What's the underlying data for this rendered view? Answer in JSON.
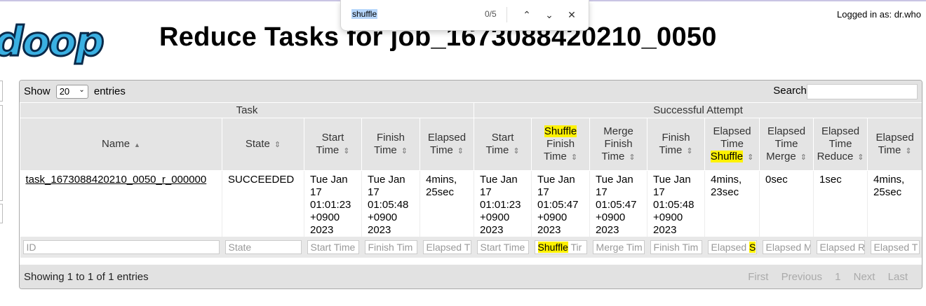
{
  "header": {
    "logo_text": "doop",
    "title": "Reduce Tasks for job_1673088420210_0050",
    "logged_in": "Logged in as: dr.who"
  },
  "find_bar": {
    "query": "shuffle",
    "count": "0/5",
    "prev_icon": "chevron-up",
    "next_icon": "chevron-down",
    "close_icon": "close"
  },
  "table_controls": {
    "show_label": "Show",
    "page_length": "20",
    "entries_label": "entries",
    "search_label": "Search:",
    "search_value": ""
  },
  "groups": {
    "task": "Task",
    "attempt": "Successful Attempt"
  },
  "columns": [
    {
      "pre": "",
      "hl": "",
      "post": "Name"
    },
    {
      "pre": "",
      "hl": "",
      "post": "State"
    },
    {
      "pre": "Start Time",
      "hl": "",
      "post": ""
    },
    {
      "pre": "Finish Time",
      "hl": "",
      "post": ""
    },
    {
      "pre": "Elapsed Time",
      "hl": "",
      "post": ""
    },
    {
      "pre": "Start Time",
      "hl": "",
      "post": ""
    },
    {
      "pre": "",
      "hl": "Shuffle",
      "post": "Finish Time"
    },
    {
      "pre": "Merge Finish Time",
      "hl": "",
      "post": ""
    },
    {
      "pre": "Finish Time",
      "hl": "",
      "post": ""
    },
    {
      "pre": "Elapsed Time",
      "hl": "Shuffle",
      "post": ""
    },
    {
      "pre": "Elapsed Time Merge",
      "hl": "",
      "post": ""
    },
    {
      "pre": "Elapsed Time Reduce",
      "hl": "",
      "post": ""
    },
    {
      "pre": "Elapsed Time",
      "hl": "",
      "post": ""
    }
  ],
  "rows": [
    {
      "name": "task_1673088420210_0050_r_000000",
      "state": "SUCCEEDED",
      "start_time": "Tue Jan 17 01:01:23 +0900 2023",
      "finish_time": "Tue Jan 17 01:05:48 +0900 2023",
      "elapsed": "4mins, 25sec",
      "attempt_start": "Tue Jan 17 01:01:23 +0900 2023",
      "shuffle_finish": "Tue Jan 17 01:05:47 +0900 2023",
      "merge_finish": "Tue Jan 17 01:05:47 +0900 2023",
      "attempt_finish": "Tue Jan 17 01:05:48 +0900 2023",
      "elapsed_shuffle": "4mins, 23sec",
      "elapsed_merge": "0sec",
      "elapsed_reduce": "1sec",
      "attempt_elapsed": "4mins, 25sec"
    }
  ],
  "filters": [
    {
      "pre": "ID",
      "hl": "",
      "post": ""
    },
    {
      "pre": "State",
      "hl": "",
      "post": ""
    },
    {
      "pre": "Start Time",
      "hl": "",
      "post": ""
    },
    {
      "pre": "Finish Tim",
      "hl": "",
      "post": ""
    },
    {
      "pre": "Elapsed T",
      "hl": "",
      "post": ""
    },
    {
      "pre": "Start Time",
      "hl": "",
      "post": ""
    },
    {
      "pre": "",
      "hl": "Shuffle",
      "post": " Tir"
    },
    {
      "pre": "Merge Tim",
      "hl": "",
      "post": ""
    },
    {
      "pre": "Finish Tim",
      "hl": "",
      "post": ""
    },
    {
      "pre": "Elapsed ",
      "hl": "S",
      "post": ""
    },
    {
      "pre": "Elapsed M",
      "hl": "",
      "post": ""
    },
    {
      "pre": "Elapsed R",
      "hl": "",
      "post": ""
    },
    {
      "pre": "Elapsed T",
      "hl": "",
      "post": ""
    }
  ],
  "footer": {
    "info": "Showing 1 to 1 of 1 entries",
    "first": "First",
    "previous": "Previous",
    "page": "1",
    "next": "Next",
    "last": "Last"
  },
  "colors": {
    "highlight": "#fef100",
    "header_bg": "#e4e4e4",
    "logo_blue": "#3ab0e2"
  }
}
